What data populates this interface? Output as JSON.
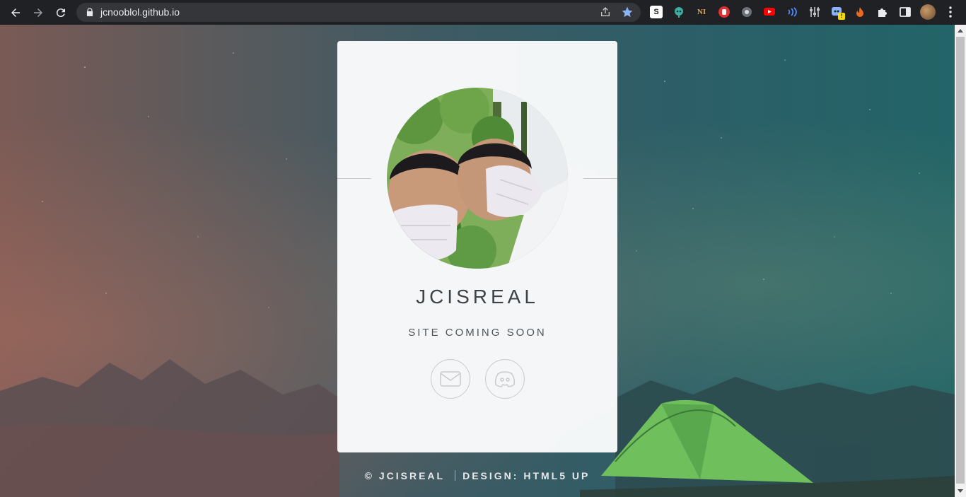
{
  "browser": {
    "url": "jcnooblol.github.io",
    "extensions": [
      {
        "name": "s-extension-icon",
        "label": "S"
      },
      {
        "name": "alien-extension-icon"
      },
      {
        "name": "ni-extension-icon",
        "label": "NI"
      },
      {
        "name": "red-hand-extension-icon"
      },
      {
        "name": "gray-extension-icon"
      },
      {
        "name": "youtube-extension-icon"
      },
      {
        "name": "wave-extension-icon"
      },
      {
        "name": "sliders-extension-icon"
      },
      {
        "name": "badge-extension-icon",
        "badge": "!"
      },
      {
        "name": "fire-extension-icon"
      },
      {
        "name": "puzzle-extensions-icon"
      },
      {
        "name": "side-panel-icon"
      }
    ]
  },
  "card": {
    "name": "JCISREAL",
    "tagline": "SITE COMING SOON",
    "links": [
      {
        "name": "email-icon"
      },
      {
        "name": "discord-icon"
      }
    ]
  },
  "footer": {
    "copyright": "© JCISREAL",
    "design": "DESIGN: HTML5 UP"
  },
  "colors": {
    "card_background": "#fafbfc",
    "text_dark": "#3d4449",
    "chrome_background": "#202124"
  }
}
